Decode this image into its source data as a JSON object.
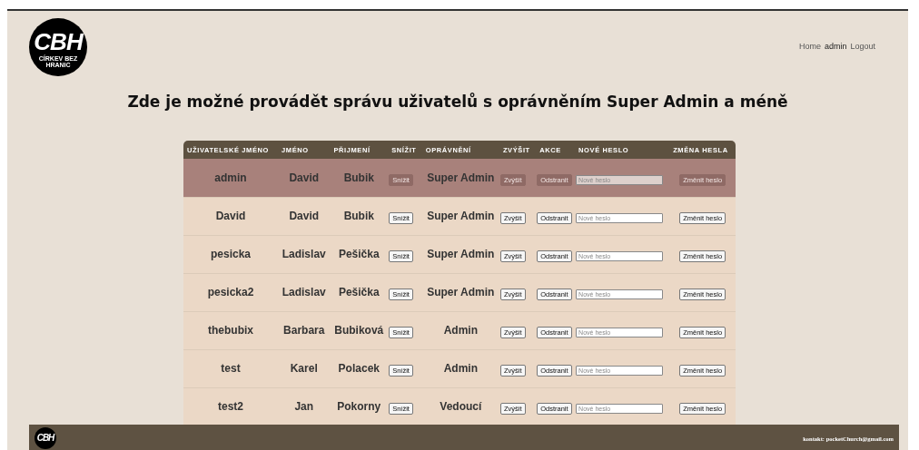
{
  "logo": {
    "text": "CBH",
    "tagline": "CÍRKEV BEZ HRANIC"
  },
  "nav": [
    {
      "label": "Home",
      "selected": false
    },
    {
      "label": "admin",
      "selected": true
    },
    {
      "label": "Logout",
      "selected": false
    }
  ],
  "heading": "Zde je možné provádět správu uživatelů s oprávněním Super Admin a méně",
  "table": {
    "columns": [
      "UŽIVATELSKÉ JMÉNO",
      "JMÉNO",
      "PŘIJMENÍ",
      "SNÍŽIT",
      "OPRÁVNĚNÍ",
      "ZVÝŠIT",
      "AKCE",
      "NOVÉ HESLO",
      "ZMĚNA HESLA"
    ],
    "rows": [
      {
        "username": "admin",
        "first_name": "David",
        "last_name": "Bubik",
        "lower": "Snížit",
        "role": "Super Admin",
        "raise": "Zvýšit",
        "action": "Odstranit",
        "password_placeholder": "Nové heslo",
        "change": "Změnit heslo",
        "disabled": true
      },
      {
        "username": "David",
        "first_name": "David",
        "last_name": "Bubik",
        "lower": "Snížit",
        "role": "Super Admin",
        "raise": "Zvýšit",
        "action": "Odstranit",
        "password_placeholder": "Nové heslo",
        "change": "Změnit heslo",
        "disabled": false
      },
      {
        "username": "pesicka",
        "first_name": "Ladislav",
        "last_name": "Pešička",
        "lower": "Snížit",
        "role": "Super Admin",
        "raise": "Zvýšit",
        "action": "Odstranit",
        "password_placeholder": "Nové heslo",
        "change": "Změnit heslo",
        "disabled": false
      },
      {
        "username": "pesicka2",
        "first_name": "Ladislav",
        "last_name": "Pešička",
        "lower": "Snížit",
        "role": "Super Admin",
        "raise": "Zvýšit",
        "action": "Odstranit",
        "password_placeholder": "Nové heslo",
        "change": "Změnit heslo",
        "disabled": false
      },
      {
        "username": "thebubix",
        "first_name": "Barbara",
        "last_name": "Bubiková",
        "lower": "Snížit",
        "role": "Admin",
        "raise": "Zvýšit",
        "action": "Odstranit",
        "password_placeholder": "Nové heslo",
        "change": "Změnit heslo",
        "disabled": false
      },
      {
        "username": "test",
        "first_name": "Karel",
        "last_name": "Polacek",
        "lower": "Snížit",
        "role": "Admin",
        "raise": "Zvýšit",
        "action": "Odstranit",
        "password_placeholder": "Nové heslo",
        "change": "Změnit heslo",
        "disabled": false
      },
      {
        "username": "test2",
        "first_name": "Jan",
        "last_name": "Pokorny",
        "lower": "Snížit",
        "role": "Vedoucí",
        "raise": "Zvýšit",
        "action": "Odstranit",
        "password_placeholder": "Nové heslo",
        "change": "Změnit heslo",
        "disabled": false
      }
    ]
  },
  "footer": {
    "logo": {
      "text": "CBH"
    },
    "contact": "kontakt: pocketChurch@gmail.com"
  }
}
